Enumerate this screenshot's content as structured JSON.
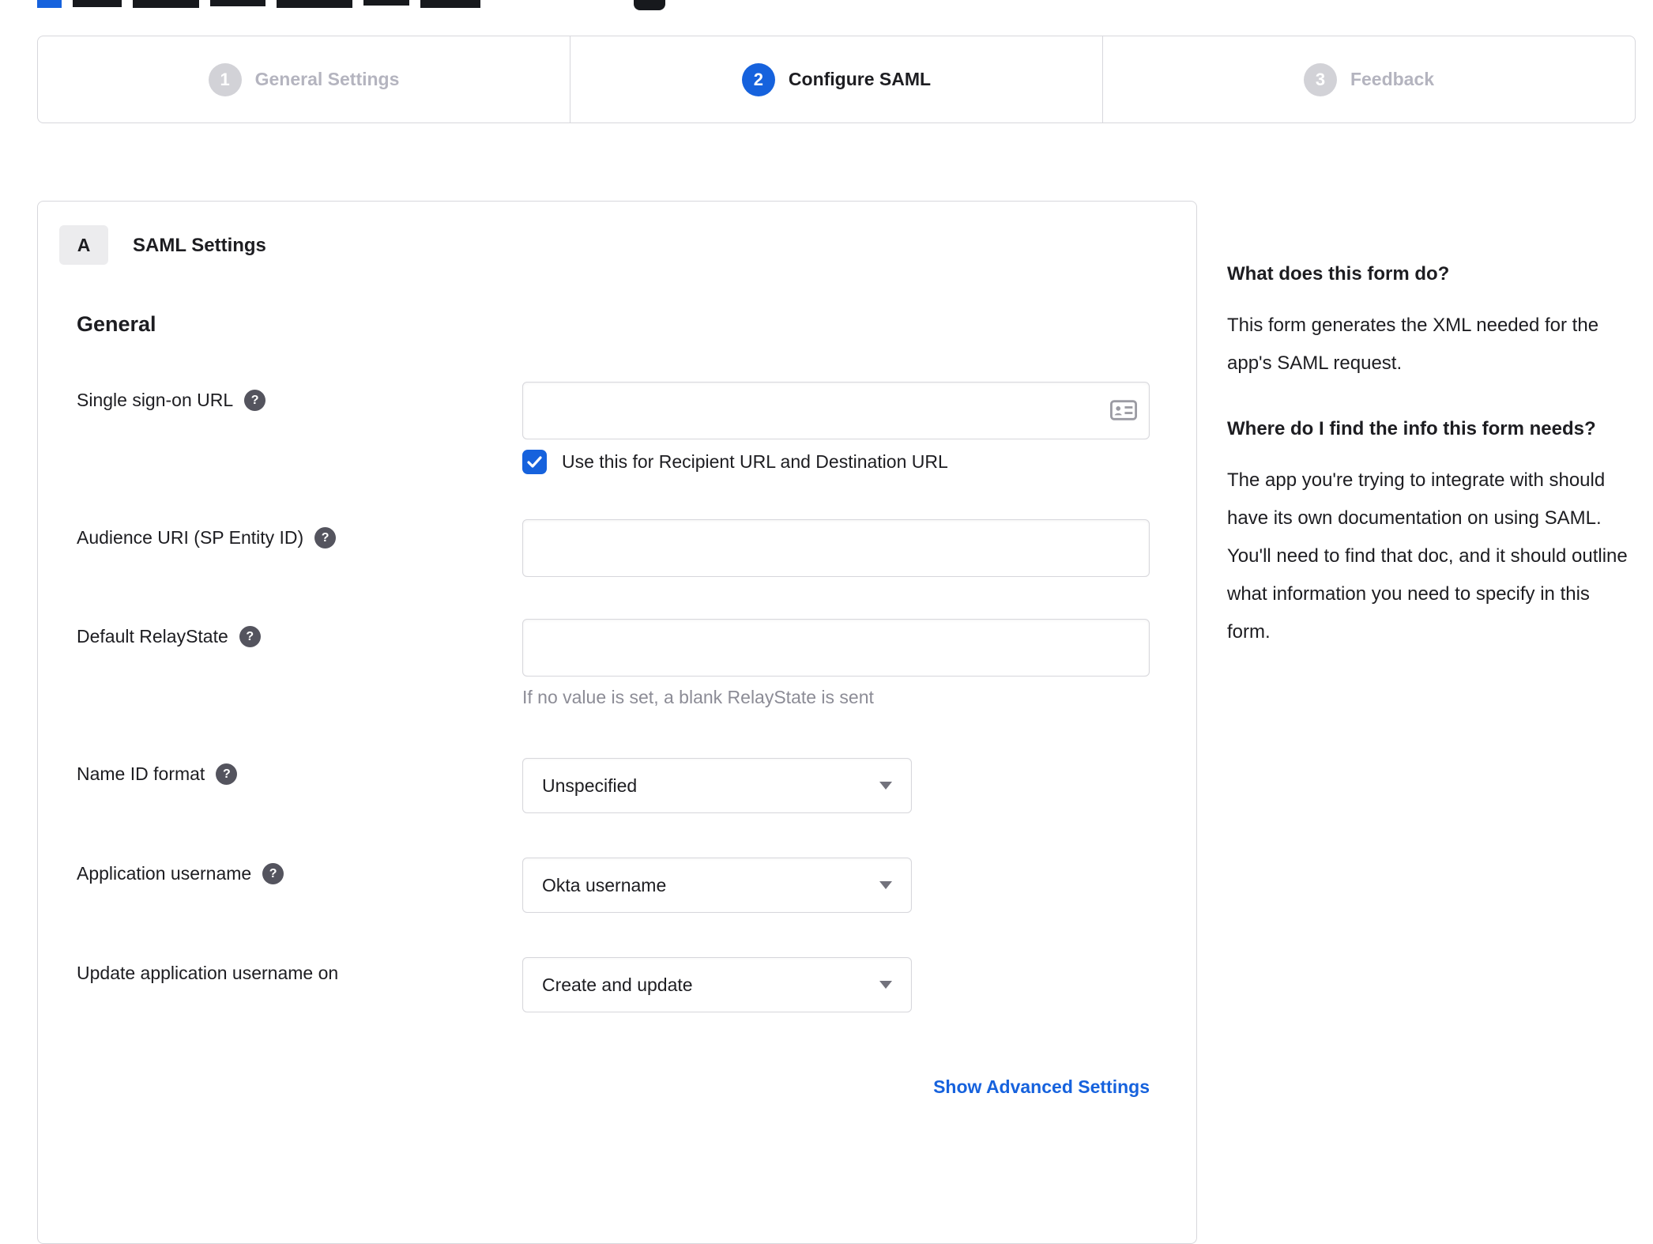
{
  "stepper": {
    "steps": [
      {
        "number": "1",
        "label": "General Settings",
        "state": "inactive"
      },
      {
        "number": "2",
        "label": "Configure SAML",
        "state": "active"
      },
      {
        "number": "3",
        "label": "Feedback",
        "state": "inactive"
      }
    ]
  },
  "panel": {
    "section_badge": "A",
    "section_title": "SAML Settings",
    "general_heading": "General",
    "fields": {
      "sso_url": {
        "label": "Single sign-on URL",
        "value": "",
        "checkbox_label": "Use this for Recipient URL and Destination URL",
        "checkbox_checked": true
      },
      "audience_uri": {
        "label": "Audience URI (SP Entity ID)",
        "value": ""
      },
      "default_relay_state": {
        "label": "Default RelayState",
        "value": "",
        "helper": "If no value is set, a blank RelayState is sent"
      },
      "name_id_format": {
        "label": "Name ID format",
        "value": "Unspecified"
      },
      "application_username": {
        "label": "Application username",
        "value": "Okta username"
      },
      "update_application_username": {
        "label": "Update application username on",
        "value": "Create and update"
      }
    },
    "advanced_link": "Show Advanced Settings"
  },
  "help_panel": {
    "q1_title": "What does this form do?",
    "q1_body": "This form generates the XML needed for the app's SAML request.",
    "q2_title": "Where do I find the info this form needs?",
    "q2_body": "The app you're trying to integrate with should have its own documentation on using SAML. You'll need to find that doc, and it should outline what information you need to specify in this form."
  },
  "icons": {
    "help_glyph": "?"
  },
  "colors": {
    "accent_blue": "#1662dd",
    "border": "#d7d7dc",
    "inactive_gray": "#d2d2d7",
    "muted_text": "#8c8c96"
  }
}
